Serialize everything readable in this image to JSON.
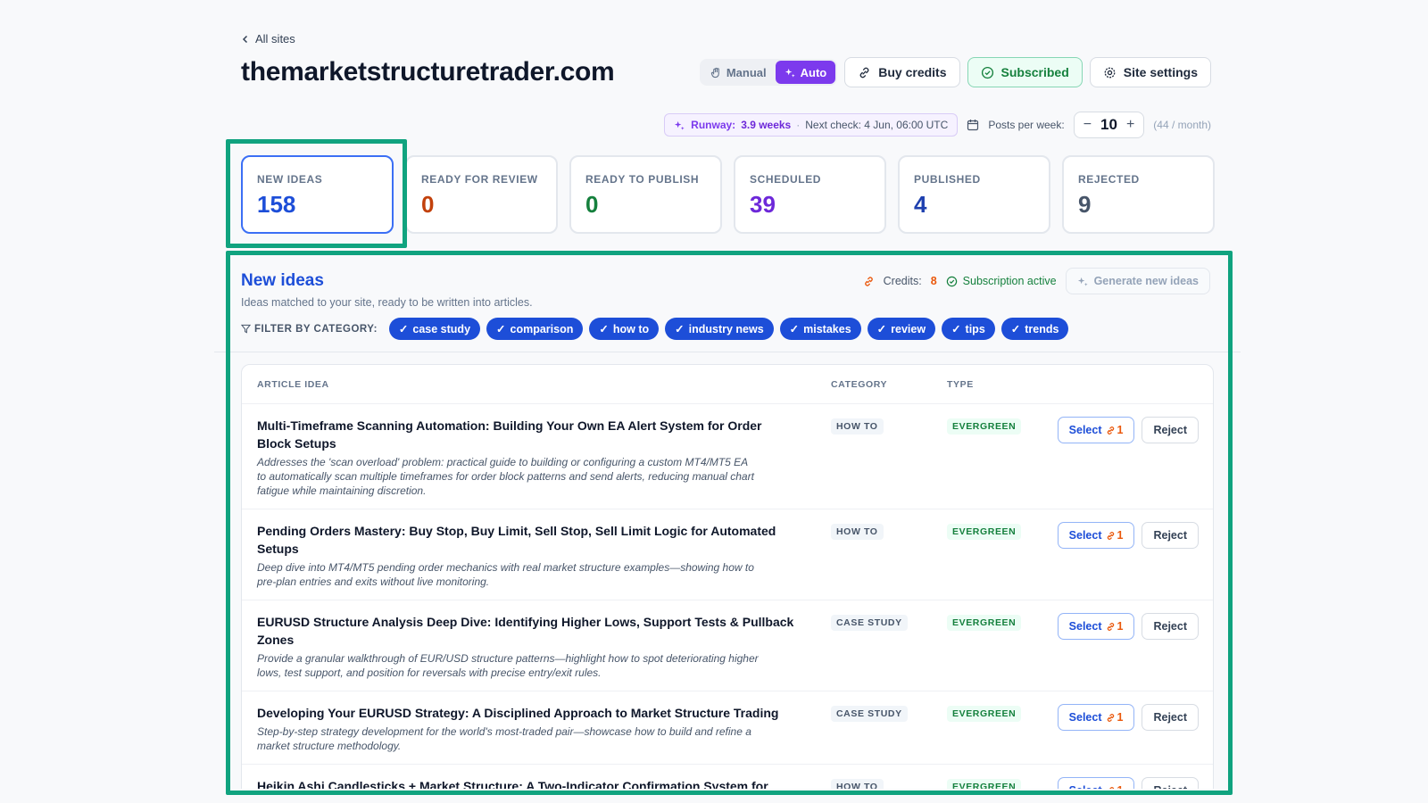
{
  "breadcrumb": {
    "label": "All sites"
  },
  "site": {
    "title": "themarketstructuretrader.com"
  },
  "header": {
    "mode_manual": "Manual",
    "mode_auto": "Auto",
    "buy_credits": "Buy credits",
    "subscribed": "Subscribed",
    "site_settings": "Site settings"
  },
  "runway": {
    "label": "Runway:",
    "value": "3.9 weeks",
    "separator": "·",
    "next_check": "Next check: 4 Jun, 06:00 UTC",
    "posts_label": "Posts per week:",
    "posts_value": "10",
    "per_month": "(44 / month)"
  },
  "stats": [
    {
      "label": "NEW IDEAS",
      "value": "158",
      "color": "#1d4ed8"
    },
    {
      "label": "READY FOR REVIEW",
      "value": "0",
      "color": "#c2410c"
    },
    {
      "label": "READY TO PUBLISH",
      "value": "0",
      "color": "#15803d"
    },
    {
      "label": "SCHEDULED",
      "value": "39",
      "color": "#6d28d9"
    },
    {
      "label": "PUBLISHED",
      "value": "4",
      "color": "#1e40af"
    },
    {
      "label": "REJECTED",
      "value": "9",
      "color": "#475569"
    }
  ],
  "section": {
    "title": "New ideas",
    "subtitle": "Ideas matched to your site, ready to be written into articles.",
    "credits_label": "Credits:",
    "credits_value": "8",
    "subscription": "Subscription active",
    "generate": "Generate new ideas",
    "filter_label": "FILTER BY CATEGORY:",
    "chips": [
      "case study",
      "comparison",
      "how to",
      "industry news",
      "mistakes",
      "review",
      "tips",
      "trends"
    ]
  },
  "table": {
    "headers": {
      "idea": "ARTICLE IDEA",
      "category": "CATEGORY",
      "type": "TYPE"
    },
    "select_label": "Select",
    "reject_label": "Reject",
    "rows": [
      {
        "title": "Multi-Timeframe Scanning Automation: Building Your Own EA Alert System for Order Block Setups",
        "desc": "Addresses the 'scan overload' problem: practical guide to building or configuring a custom MT4/MT5 EA to automatically scan multiple timeframes for order block patterns and send alerts, reducing manual chart fatigue while maintaining discretion.",
        "category": "HOW TO",
        "type": "EVERGREEN",
        "links": "1"
      },
      {
        "title": "Pending Orders Mastery: Buy Stop, Buy Limit, Sell Stop, Sell Limit Logic for Automated Setups",
        "desc": "Deep dive into MT4/MT5 pending order mechanics with real market structure examples—showing how to pre-plan entries and exits without live monitoring.",
        "category": "HOW TO",
        "type": "EVERGREEN",
        "links": "1"
      },
      {
        "title": "EURUSD Structure Analysis Deep Dive: Identifying Higher Lows, Support Tests & Pullback Zones",
        "desc": "Provide a granular walkthrough of EUR/USD structure patterns—highlight how to spot deteriorating higher lows, test support, and position for reversals with precise entry/exit rules.",
        "category": "CASE STUDY",
        "type": "EVERGREEN",
        "links": "1"
      },
      {
        "title": "Developing Your EURUSD Strategy: A Disciplined Approach to Market Structure Trading",
        "desc": "Step-by-step strategy development for the world's most-traded pair—showcase how to build and refine a market structure methodology.",
        "category": "CASE STUDY",
        "type": "EVERGREEN",
        "links": "1"
      },
      {
        "title": "Heikin Ashi Candlesticks + Market Structure: A Two-Indicator Confirmation System for High-Probability Breakouts",
        "desc": "",
        "category": "HOW TO",
        "type": "EVERGREEN",
        "links": "1"
      }
    ]
  }
}
